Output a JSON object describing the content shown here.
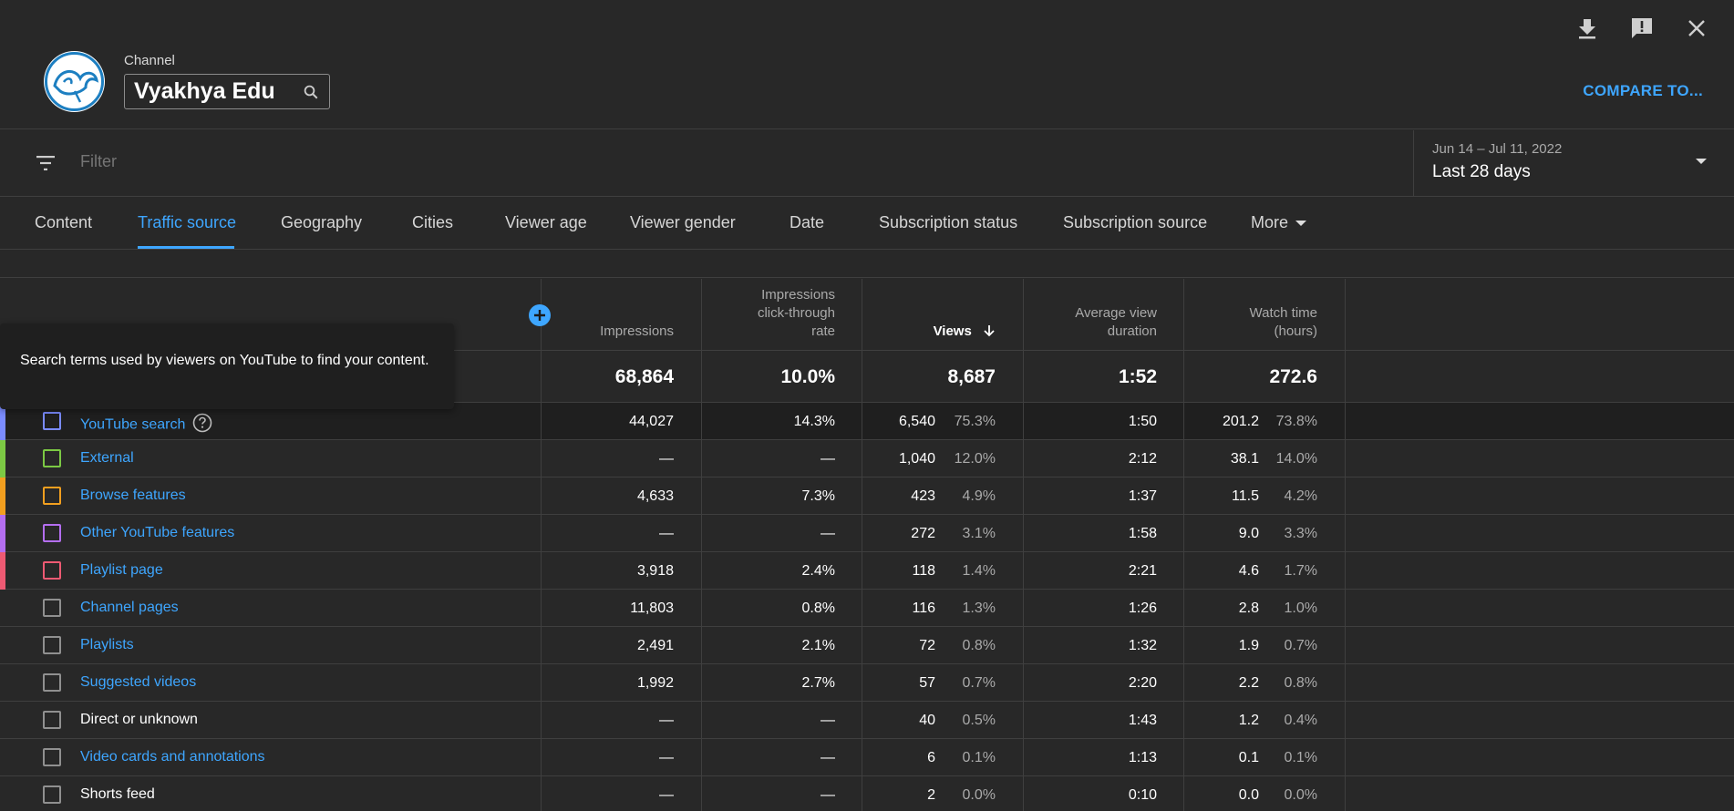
{
  "header": {
    "channel_label": "Channel",
    "channel_name": "Vyakhya Edu",
    "compare_label": "COMPARE TO..."
  },
  "icons": {
    "download": "download-icon",
    "feedback": "feedback-icon",
    "close": "close-icon",
    "search": "search-icon",
    "filter": "filter-icon",
    "help": "help-circle-icon",
    "add": "add-metric-icon",
    "sort": "arrow-down-icon"
  },
  "filter": {
    "placeholder": "Filter"
  },
  "date": {
    "range": "Jun 14 – Jul 11, 2022",
    "preset": "Last 28 days"
  },
  "tabs": [
    "Content",
    "Traffic source",
    "Geography",
    "Cities",
    "Viewer age",
    "Viewer gender",
    "Date",
    "Subscription status",
    "Subscription source",
    "More"
  ],
  "active_tab": "Traffic source",
  "columns": {
    "impressions": "Impressions",
    "ctr": "Impressions click-through rate",
    "ctr_lines": [
      "Impressions",
      "click-through",
      "rate"
    ],
    "views": "Views",
    "avd": "Average view duration",
    "avd_lines": [
      "Average view",
      "duration"
    ],
    "watch": "Watch time (hours)",
    "watch_lines": [
      "Watch time",
      "(hours)"
    ]
  },
  "totals": {
    "impressions": "68,864",
    "ctr": "10.0%",
    "views": "8,687",
    "avd": "1:52",
    "watch": "272.6"
  },
  "tooltip": "Search terms used by viewers on YouTube to find your content.",
  "rows": [
    {
      "name": "YouTube search",
      "link": true,
      "color": "#7b8cff",
      "impressions": "44,027",
      "ctr": "14.3%",
      "views": "6,540",
      "views_pct": "75.3%",
      "avd": "1:50",
      "watch": "201.2",
      "watch_pct": "73.8%"
    },
    {
      "name": "External",
      "link": true,
      "color": "#7cc944",
      "impressions": "—",
      "ctr": "—",
      "views": "1,040",
      "views_pct": "12.0%",
      "avd": "2:12",
      "watch": "38.1",
      "watch_pct": "14.0%"
    },
    {
      "name": "Browse features",
      "link": true,
      "color": "#f29f1f",
      "impressions": "4,633",
      "ctr": "7.3%",
      "views": "423",
      "views_pct": "4.9%",
      "avd": "1:37",
      "watch": "11.5",
      "watch_pct": "4.2%"
    },
    {
      "name": "Other YouTube features",
      "link": true,
      "color": "#b46ef0",
      "impressions": "—",
      "ctr": "—",
      "views": "272",
      "views_pct": "3.1%",
      "avd": "1:58",
      "watch": "9.0",
      "watch_pct": "3.3%"
    },
    {
      "name": "Playlist page",
      "link": true,
      "color": "#ee5a73",
      "impressions": "3,918",
      "ctr": "2.4%",
      "views": "118",
      "views_pct": "1.4%",
      "avd": "2:21",
      "watch": "4.6",
      "watch_pct": "1.7%"
    },
    {
      "name": "Channel pages",
      "link": true,
      "color": "",
      "impressions": "11,803",
      "ctr": "0.8%",
      "views": "116",
      "views_pct": "1.3%",
      "avd": "1:26",
      "watch": "2.8",
      "watch_pct": "1.0%"
    },
    {
      "name": "Playlists",
      "link": true,
      "color": "",
      "impressions": "2,491",
      "ctr": "2.1%",
      "views": "72",
      "views_pct": "0.8%",
      "avd": "1:32",
      "watch": "1.9",
      "watch_pct": "0.7%"
    },
    {
      "name": "Suggested videos",
      "link": true,
      "color": "",
      "impressions": "1,992",
      "ctr": "2.7%",
      "views": "57",
      "views_pct": "0.7%",
      "avd": "2:20",
      "watch": "2.2",
      "watch_pct": "0.8%"
    },
    {
      "name": "Direct or unknown",
      "link": false,
      "color": "",
      "impressions": "—",
      "ctr": "—",
      "views": "40",
      "views_pct": "0.5%",
      "avd": "1:43",
      "watch": "1.2",
      "watch_pct": "0.4%"
    },
    {
      "name": "Video cards and annotations",
      "link": true,
      "color": "",
      "impressions": "—",
      "ctr": "—",
      "views": "6",
      "views_pct": "0.1%",
      "avd": "1:13",
      "watch": "0.1",
      "watch_pct": "0.1%"
    },
    {
      "name": "Shorts feed",
      "link": false,
      "color": "",
      "impressions": "—",
      "ctr": "—",
      "views": "2",
      "views_pct": "0.0%",
      "avd": "0:10",
      "watch": "0.0",
      "watch_pct": "0.0%"
    }
  ]
}
